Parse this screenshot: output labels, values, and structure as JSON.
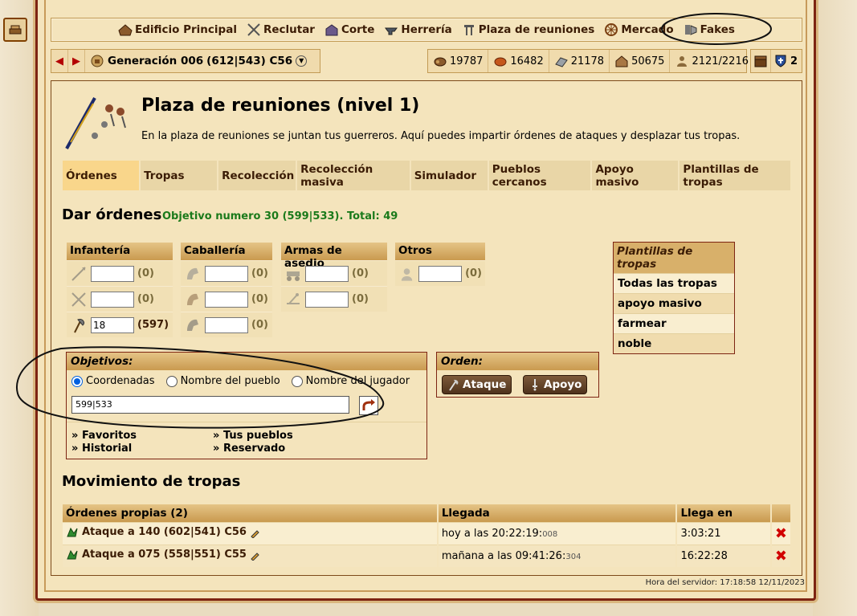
{
  "nav": {
    "items": [
      {
        "label": "Edificio Principal",
        "icon": "main-building-icon"
      },
      {
        "label": "Reclutar",
        "icon": "swords-icon"
      },
      {
        "label": "Corte",
        "icon": "court-icon"
      },
      {
        "label": "Herrería",
        "icon": "anvil-icon"
      },
      {
        "label": "Plaza de reuniones",
        "icon": "rally-point-icon"
      },
      {
        "label": "Mercado",
        "icon": "market-wheel-icon"
      },
      {
        "label": "Fakes",
        "icon": "fakes-icon"
      }
    ]
  },
  "village": {
    "name": "Generación 006",
    "coords": "(612|543) C56"
  },
  "resources": {
    "wood": "19787",
    "clay": "16482",
    "iron": "21178",
    "storage": "50675",
    "population": "2121/2216",
    "incoming_count": "2"
  },
  "page": {
    "title": "Plaza de reuniones (nivel 1)",
    "description": "En la plaza de reuniones se juntan tus guerreros. Aquí puedes impartir órdenes de ataques y desplazar tus tropas."
  },
  "tabs": [
    {
      "label": "Órdenes",
      "active": true
    },
    {
      "label": "Tropas",
      "active": false
    },
    {
      "label": "Recolección",
      "active": false
    },
    {
      "label": "Recolección masiva",
      "active": false
    },
    {
      "label": "Simulador",
      "active": false
    },
    {
      "label": "Pueblos cercanos",
      "active": false
    },
    {
      "label": "Apoyo masivo",
      "active": false
    },
    {
      "label": "Plantillas de tropas",
      "active": false
    }
  ],
  "orders": {
    "heading": "Dar órdenes",
    "objective_note": "Objetivo numero 30 (599|533). Total: 49"
  },
  "units": {
    "infantry": {
      "header": "Infantería",
      "rows": [
        {
          "unit": "spear-icon",
          "value": "",
          "count": "(0)"
        },
        {
          "unit": "sword-icon",
          "value": "",
          "count": "(0)"
        },
        {
          "unit": "axe-icon",
          "value": "18",
          "count": "(597)"
        }
      ]
    },
    "cavalry": {
      "header": "Caballería",
      "rows": [
        {
          "unit": "scout-icon",
          "value": "",
          "count": "(0)"
        },
        {
          "unit": "light-cavalry-icon",
          "value": "",
          "count": "(0)"
        },
        {
          "unit": "heavy-cavalry-icon",
          "value": "",
          "count": "(0)"
        }
      ]
    },
    "siege": {
      "header": "Armas de asedio",
      "rows": [
        {
          "unit": "ram-icon",
          "value": "",
          "count": "(0)"
        },
        {
          "unit": "catapult-icon",
          "value": "",
          "count": "(0)"
        }
      ]
    },
    "others": {
      "header": "Otros",
      "rows": [
        {
          "unit": "noble-icon",
          "value": "",
          "count": "(0)"
        }
      ]
    }
  },
  "templates": {
    "header": "Plantillas de tropas",
    "items": [
      "Todas las tropas",
      "apoyo masivo",
      "farmear",
      "noble"
    ]
  },
  "objectives": {
    "header": "Objetivos:",
    "radio_coords": "Coordenadas",
    "radio_village": "Nombre del pueblo",
    "radio_player": "Nombre del jugador",
    "coords_value": "599|533",
    "links_left": [
      "Favoritos",
      "Historial"
    ],
    "links_right": [
      "Tus pueblos",
      "Reservado"
    ]
  },
  "order_box": {
    "header": "Orden:",
    "attack": "Ataque",
    "support": "Apoyo"
  },
  "movements": {
    "heading": "Movimiento de tropas",
    "columns": [
      "Órdenes propias (2)",
      "Llegada",
      "Llega en"
    ],
    "rows": [
      {
        "label": "Ataque a 140 (602|541) C56",
        "arrival": "hoy a las 20:22:19:",
        "ms": "008",
        "eta": "3:03:21"
      },
      {
        "label": "Ataque a 075 (558|551) C55",
        "arrival": "mañana a las 09:41:26:",
        "ms": "304",
        "eta": "16:22:28"
      }
    ]
  },
  "server_time": "Hora del servidor: 17:18:58 12/11/2023",
  "colors": {
    "panel": "#f4e4bc",
    "header": "#d8b06a",
    "border": "#7d2412",
    "objective_green": "#1b7a1b",
    "delete_red": "#d10000"
  }
}
